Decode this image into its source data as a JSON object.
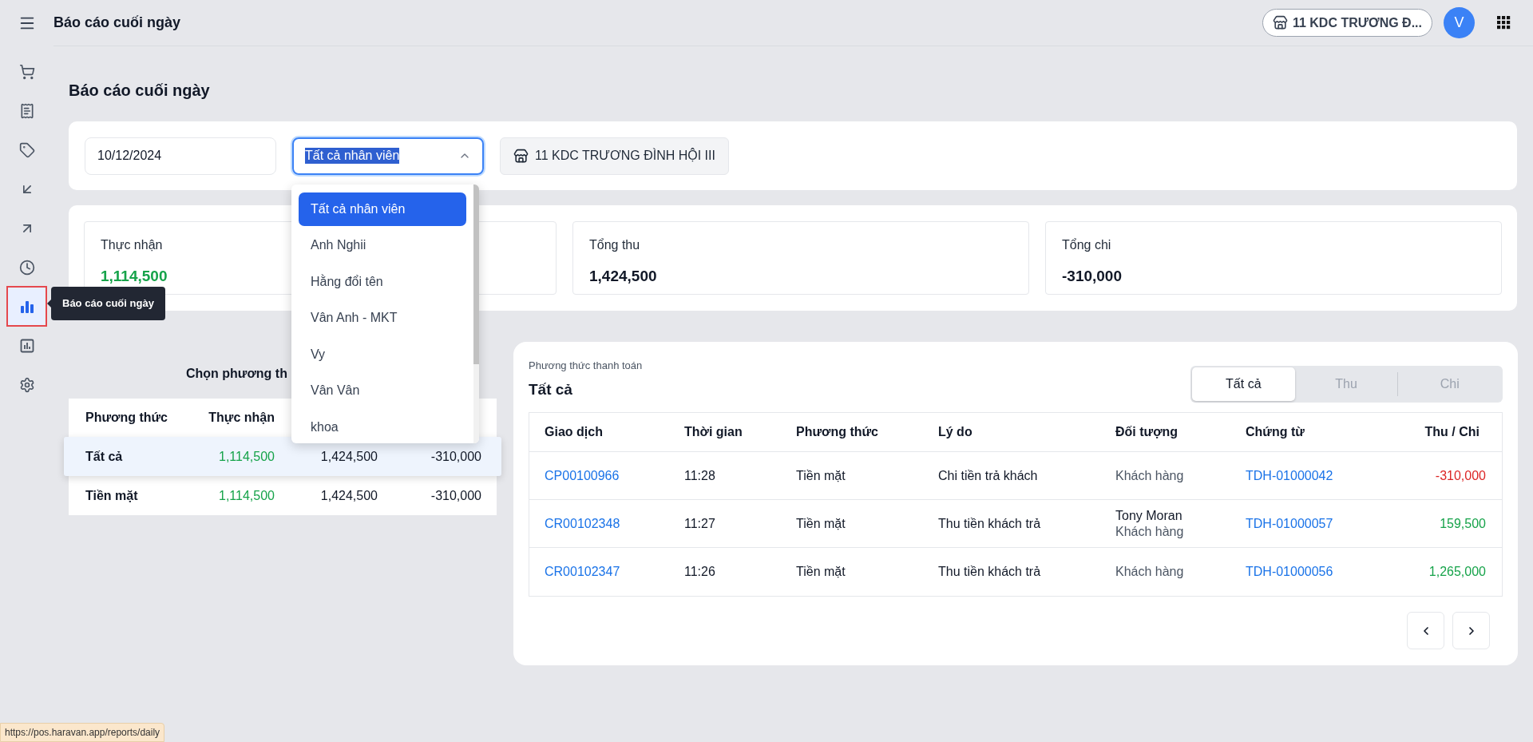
{
  "header": {
    "title": "Báo cáo cuối ngày",
    "store": "11 KDC TRƯƠNG Đ...",
    "avatar": "V"
  },
  "sidebar": {
    "items": [
      {
        "selected": false
      },
      {
        "selected": false
      },
      {
        "selected": false
      },
      {
        "selected": false
      },
      {
        "selected": false
      },
      {
        "selected": false
      },
      {
        "selected": true
      },
      {
        "selected": false
      },
      {
        "selected": false
      }
    ],
    "tooltip": "Báo cáo cuối ngày"
  },
  "page_title": "Báo cáo cuối ngày",
  "filters": {
    "date": "10/12/2024",
    "employee_select": {
      "value": "Tất cả nhân viên",
      "expanded": true,
      "options": [
        {
          "label": "Tất cả nhân viên",
          "selected": true
        },
        {
          "label": "Anh Nghii",
          "selected": false
        },
        {
          "label": "Hằng đổi tên",
          "selected": false
        },
        {
          "label": "Vân Anh - MKT",
          "selected": false
        },
        {
          "label": "Vy",
          "selected": false
        },
        {
          "label": "Vân Vân",
          "selected": false
        },
        {
          "label": "khoa",
          "selected": false
        }
      ]
    },
    "store": "11 KDC TRƯƠNG ĐÌNH HỘI III"
  },
  "stats": [
    {
      "label": "Thực nhận",
      "value": "1,114,500",
      "color": "#16a34a"
    },
    {
      "covered": true
    },
    {
      "label": "Tổng thu",
      "value": "1,424,500",
      "color": "#111827"
    },
    {
      "label": "Tổng chi",
      "value": "-310,000",
      "color": "#111827"
    }
  ],
  "methods": {
    "heading": "Chọn phương th",
    "columns": [
      "Phương thức",
      "Thực nhận"
    ],
    "rows": [
      {
        "name": "Tất cả",
        "net": "1,114,500",
        "income": "1,424,500",
        "expense": "-310,000",
        "selected": true
      },
      {
        "name": "Tiền mặt",
        "net": "1,114,500",
        "income": "1,424,500",
        "expense": "-310,000",
        "selected": false
      }
    ]
  },
  "transactions": {
    "caption": "Phương thức thanh toán",
    "title": "Tất cả",
    "tabs": [
      {
        "label": "Tất cả",
        "selected": true
      },
      {
        "label": "Thu",
        "selected": false
      },
      {
        "label": "Chi",
        "selected": false
      }
    ],
    "columns": [
      "Giao dịch",
      "Thời gian",
      "Phương thức",
      "Lý do",
      "Đối tượng",
      "Chứng từ",
      "Thu / Chi"
    ],
    "rows": [
      {
        "code": "CP00100966",
        "time": "11:28",
        "method": "Tiền mặt",
        "reason": "Chi tiền trả khách",
        "party_type": "Khách hàng",
        "voucher": "TDH-01000042",
        "amount": "-310,000",
        "kind": "chi"
      },
      {
        "code": "CR00102348",
        "time": "11:27",
        "method": "Tiền mặt",
        "reason": "Thu tiền khách trả",
        "party_name": "Tony Moran",
        "party_type": "Khách hàng",
        "voucher": "TDH-01000057",
        "amount": "159,500",
        "kind": "thu"
      },
      {
        "code": "CR00102347",
        "time": "11:26",
        "method": "Tiền mặt",
        "reason": "Thu tiền khách trả",
        "party_type": "Khách hàng",
        "voucher": "TDH-01000056",
        "amount": "1,265,000",
        "kind": "thu"
      }
    ]
  },
  "status_url": "https://pos.haravan.app/reports/daily"
}
